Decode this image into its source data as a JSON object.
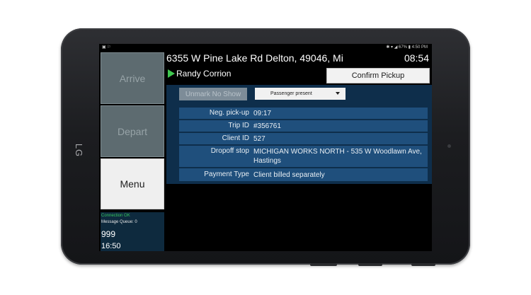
{
  "device": {
    "brand": "LG"
  },
  "status_bar": {
    "left_icons": "▣ ⚐",
    "right_text": "✱ ▾ ◢ 67% ▮ 4:50 PM"
  },
  "nav": {
    "arrive_label": "Arrive",
    "depart_label": "Depart",
    "menu_label": "Menu"
  },
  "left_info": {
    "connection": "Connection OK",
    "message_queue": "Message Queue: 0",
    "count": "999",
    "time": "16:50"
  },
  "header": {
    "address": "6355 W Pine Lake Rd Delton, 49046, Mi",
    "clock": "08:54"
  },
  "passenger": {
    "name": "Randy Corrion",
    "flag_color": "#3fc74f"
  },
  "actions": {
    "confirm_label": "Confirm Pickup",
    "unmark_label": "Unmark No Show",
    "status_select": "Passenger present"
  },
  "details": [
    {
      "label": "Neg. pick-up",
      "value": "09:17"
    },
    {
      "label": "Trip ID",
      "value": "#356761"
    },
    {
      "label": "Client ID",
      "value": "527"
    },
    {
      "label": "Dropoff stop",
      "value": "MICHIGAN WORKS NORTH - 535 W Woodlawn Ave, Hastings"
    },
    {
      "label": "Payment Type",
      "value": "Client billed separately"
    }
  ],
  "colors": {
    "panel_bg": "#0e2e4b",
    "row_bg": "#1f4f7c",
    "nav_disabled": "#5d6b70",
    "connection_ok": "#35c45a"
  }
}
